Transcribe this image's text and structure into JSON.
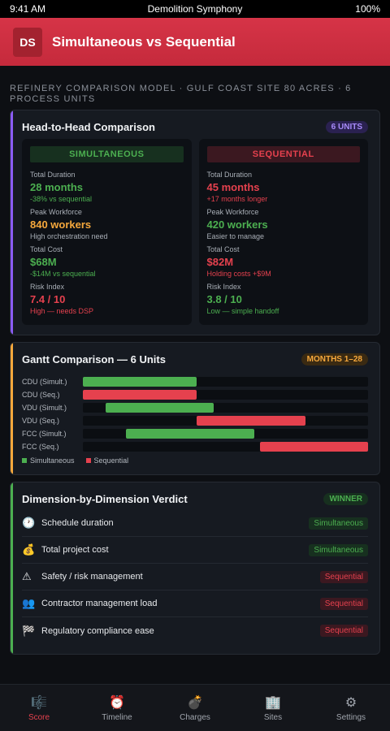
{
  "status": {
    "time": "9:41 AM",
    "carrier_title": "Demolition Symphony",
    "battery": "100%"
  },
  "header": {
    "logo": "DS",
    "title": "Simultaneous vs Sequential"
  },
  "subtitle": "REFINERY COMPARISON MODEL · GULF COAST SITE 80 ACRES · 6 PROCESS UNITS",
  "comparison": {
    "title": "Head-to-Head Comparison",
    "badge": "6 UNITS",
    "columns": [
      {
        "name": "SIMULTANEOUS",
        "metrics": [
          {
            "label": "Total Duration",
            "value": "28 months",
            "note": "-38% vs sequential",
            "value_color": "#4caf50",
            "note_color": "#4caf50"
          },
          {
            "label": "Peak Workforce",
            "value": "840 workers",
            "note": "High orchestration need",
            "value_color": "#f6a83c",
            "note_color": "#a8aeb6"
          },
          {
            "label": "Total Cost",
            "value": "$68M",
            "note": "-$14M vs sequential",
            "value_color": "#4caf50",
            "note_color": "#4caf50"
          },
          {
            "label": "Risk Index",
            "value": "7.4 / 10",
            "note": "High — needs DSP",
            "value_color": "#e5414e",
            "note_color": "#e5414e"
          }
        ]
      },
      {
        "name": "SEQUENTIAL",
        "metrics": [
          {
            "label": "Total Duration",
            "value": "45 months",
            "note": "+17 months longer",
            "value_color": "#e5414e",
            "note_color": "#e5414e"
          },
          {
            "label": "Peak Workforce",
            "value": "420 workers",
            "note": "Easier to manage",
            "value_color": "#4caf50",
            "note_color": "#a8aeb6"
          },
          {
            "label": "Total Cost",
            "value": "$82M",
            "note": "Holding costs +$9M",
            "value_color": "#e5414e",
            "note_color": "#e5414e"
          },
          {
            "label": "Risk Index",
            "value": "3.8 / 10",
            "note": "Low — simple handoff",
            "value_color": "#4caf50",
            "note_color": "#4caf50"
          }
        ]
      }
    ]
  },
  "gantt": {
    "title": "Gantt Comparison — 6 Units",
    "badge": "MONTHS 1–28",
    "total_span": 1,
    "rows": [
      {
        "label": "CDU (Simult.)",
        "start": 0.0,
        "end": 0.4,
        "kind": "sim"
      },
      {
        "label": "CDU (Seq.)",
        "start": 0.0,
        "end": 0.4,
        "kind": "seq"
      },
      {
        "label": "VDU (Simult.)",
        "start": 0.08,
        "end": 0.46,
        "kind": "sim"
      },
      {
        "label": "VDU (Seq.)",
        "start": 0.4,
        "end": 0.78,
        "kind": "seq"
      },
      {
        "label": "FCC (Simult.)",
        "start": 0.15,
        "end": 0.6,
        "kind": "sim"
      },
      {
        "label": "FCC (Seq.)",
        "start": 0.62,
        "end": 1.0,
        "kind": "seq"
      }
    ],
    "legend": [
      {
        "label": "Simultaneous",
        "kind": "sim"
      },
      {
        "label": "Sequential",
        "kind": "seq"
      }
    ]
  },
  "verdict": {
    "title": "Dimension-by-Dimension Verdict",
    "badge": "WINNER",
    "rows": [
      {
        "icon": "🕐",
        "icon_name": "clock-icon",
        "label": "Schedule duration",
        "winner": "Simultaneous",
        "kind": "sim"
      },
      {
        "icon": "💰",
        "icon_name": "money-bag-icon",
        "label": "Total project cost",
        "winner": "Simultaneous",
        "kind": "sim"
      },
      {
        "icon": "⚠",
        "icon_name": "warning-icon",
        "label": "Safety / risk management",
        "winner": "Sequential",
        "kind": "seq"
      },
      {
        "icon": "👥",
        "icon_name": "people-icon",
        "label": "Contractor management load",
        "winner": "Sequential",
        "kind": "seq"
      },
      {
        "icon": "🏁",
        "icon_name": "checkered-flag-icon",
        "label": "Regulatory compliance ease",
        "winner": "Sequential",
        "kind": "seq"
      }
    ]
  },
  "tabs": [
    {
      "icon": "🎼",
      "icon_name": "score-icon",
      "label": "Score",
      "active": true
    },
    {
      "icon": "⏰",
      "icon_name": "alarm-clock-icon",
      "label": "Timeline",
      "active": false
    },
    {
      "icon": "💣",
      "icon_name": "bomb-icon",
      "label": "Charges",
      "active": false
    },
    {
      "icon": "🏢",
      "icon_name": "building-icon",
      "label": "Sites",
      "active": false
    },
    {
      "icon": "⚙",
      "icon_name": "gear-icon",
      "label": "Settings",
      "active": false
    }
  ],
  "colors": {
    "sim": "#4caf50",
    "seq": "#e5414e",
    "accent_comparison": "#8b5cf6",
    "accent_gantt": "#f6a83c",
    "accent_verdict": "#4caf50"
  }
}
